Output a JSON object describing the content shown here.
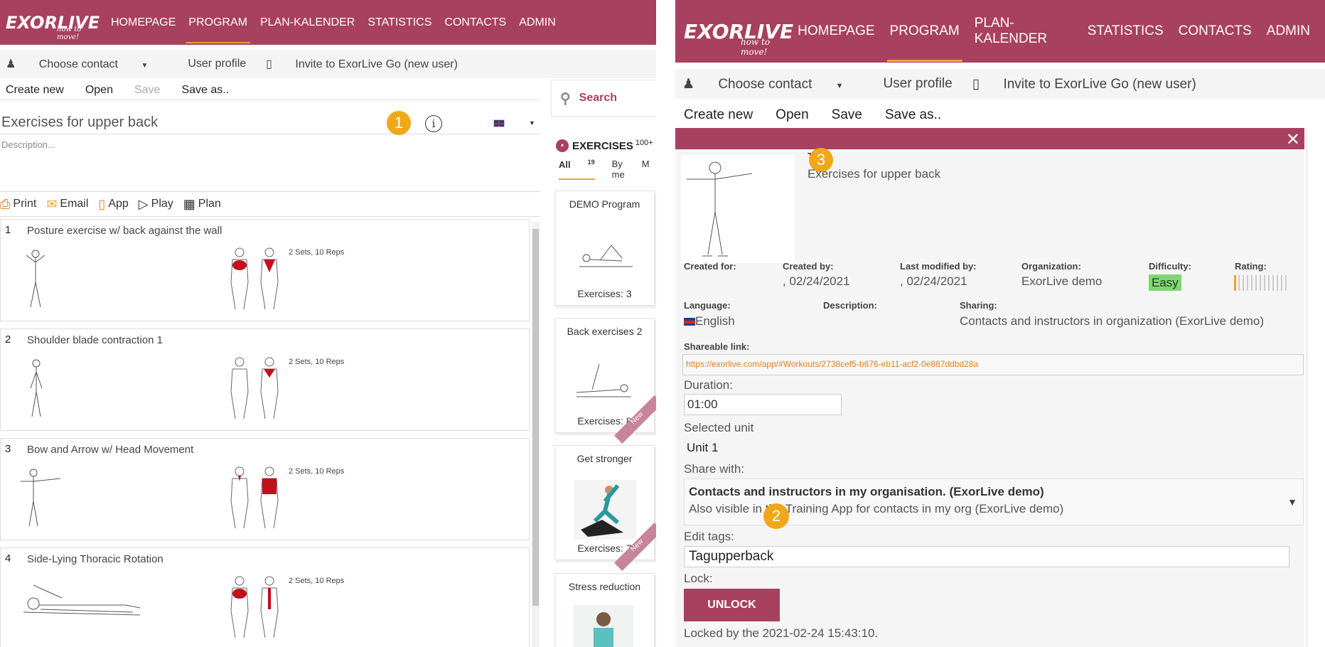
{
  "left": {
    "logo": {
      "brand": "EXORLIVE",
      "slogan": "how to move!"
    },
    "nav": [
      "HOMEPAGE",
      "PROGRAM",
      "PLAN-KALENDER",
      "STATISTICS",
      "CONTACTS",
      "ADMIN"
    ],
    "subbar": {
      "choose_contact": "Choose contact",
      "user_profile": "User profile",
      "invite": "Invite to ExorLive Go (new user)"
    },
    "cmd": {
      "create_new": "Create new",
      "open": "Open",
      "save": "Save",
      "save_as": "Save as.."
    },
    "program_title": "Exercises for upper back",
    "description_placeholder": "Description...",
    "badge": "1",
    "actions": {
      "print": "Print",
      "email": "Email",
      "app": "App",
      "play": "Play",
      "plan": "Plan"
    },
    "exercises": [
      {
        "num": "1",
        "name": "Posture exercise w/ back against the wall",
        "sets": "2 Sets, 10 Reps"
      },
      {
        "num": "2",
        "name": "Shoulder blade contraction 1",
        "sets": "2 Sets, 10 Reps"
      },
      {
        "num": "3",
        "name": "Bow and Arrow w/ Head Movement",
        "sets": "2 Sets, 10 Reps"
      },
      {
        "num": "4",
        "name": "Side-Lying Thoracic Rotation",
        "sets": "2 Sets, 10 Reps"
      }
    ],
    "search": "Search",
    "exercises_panel": {
      "title": "EXERCISES",
      "count": "100+",
      "tab_all": "All",
      "tab_all_count": "19",
      "tab_byme": "By me",
      "tab_more": "M"
    },
    "programs": [
      {
        "title": "DEMO Program",
        "count": "Exercises: 3",
        "new": ""
      },
      {
        "title": "Back exercises 2",
        "count": "Exercises: 8",
        "new": "New"
      },
      {
        "title": "Get stronger",
        "count": "Exercises: 7",
        "new": "New"
      },
      {
        "title": "Stress reduction",
        "count": "",
        "new": ""
      }
    ]
  },
  "right": {
    "logo": {
      "brand": "EXORLIVE",
      "slogan": "how to move!"
    },
    "nav": [
      "HOMEPAGE",
      "PROGRAM",
      "PLAN-KALENDER",
      "STATISTICS",
      "CONTACTS",
      "ADMIN"
    ],
    "subbar": {
      "choose_contact": "Choose contact",
      "user_profile": "User profile",
      "invite": "Invite to ExorLive Go (new user)"
    },
    "cmd": {
      "create_new": "Create new",
      "open": "Open",
      "save": "Save",
      "save_as": "Save as.."
    },
    "dialog": {
      "close": "✕",
      "title_label": "T",
      "title": "Exercises for upper back",
      "badge3": "3",
      "created_for_label": "Created for:",
      "created_by_label": "Created by:",
      "created_by": ", 02/24/2021",
      "modified_label": "Last modified by:",
      "modified": ", 02/24/2021",
      "org_label": "Organization:",
      "org": "ExorLive demo",
      "difficulty_label": "Difficulty:",
      "difficulty": "Easy",
      "rating_label": "Rating:",
      "language_label": "Language:",
      "language": "English",
      "description_label": "Description:",
      "sharing_label": "Sharing:",
      "sharing": "Contacts and instructors in organization (ExorLive demo)",
      "link_label": "Shareable link:",
      "link": "https://exorlive.com/app/#Workouts/2738cef5-b676-eb11-acf2-0e887ddbd28a",
      "duration_label": "Duration:",
      "duration": "01:00",
      "unit_label": "Selected unit",
      "unit": "Unit 1",
      "share_with_label": "Share with:",
      "share_main": "Contacts and instructors in my organisation. (ExorLive demo)",
      "share_sub": "Also visible in the Training App for contacts in my org (ExorLive demo)",
      "badge2": "2",
      "tags_label": "Edit tags:",
      "tags": "Tagupperback",
      "lock_label": "Lock:",
      "unlock": "UNLOCK",
      "locked_by": "Locked by the 2021-02-24 15:43:10."
    }
  }
}
